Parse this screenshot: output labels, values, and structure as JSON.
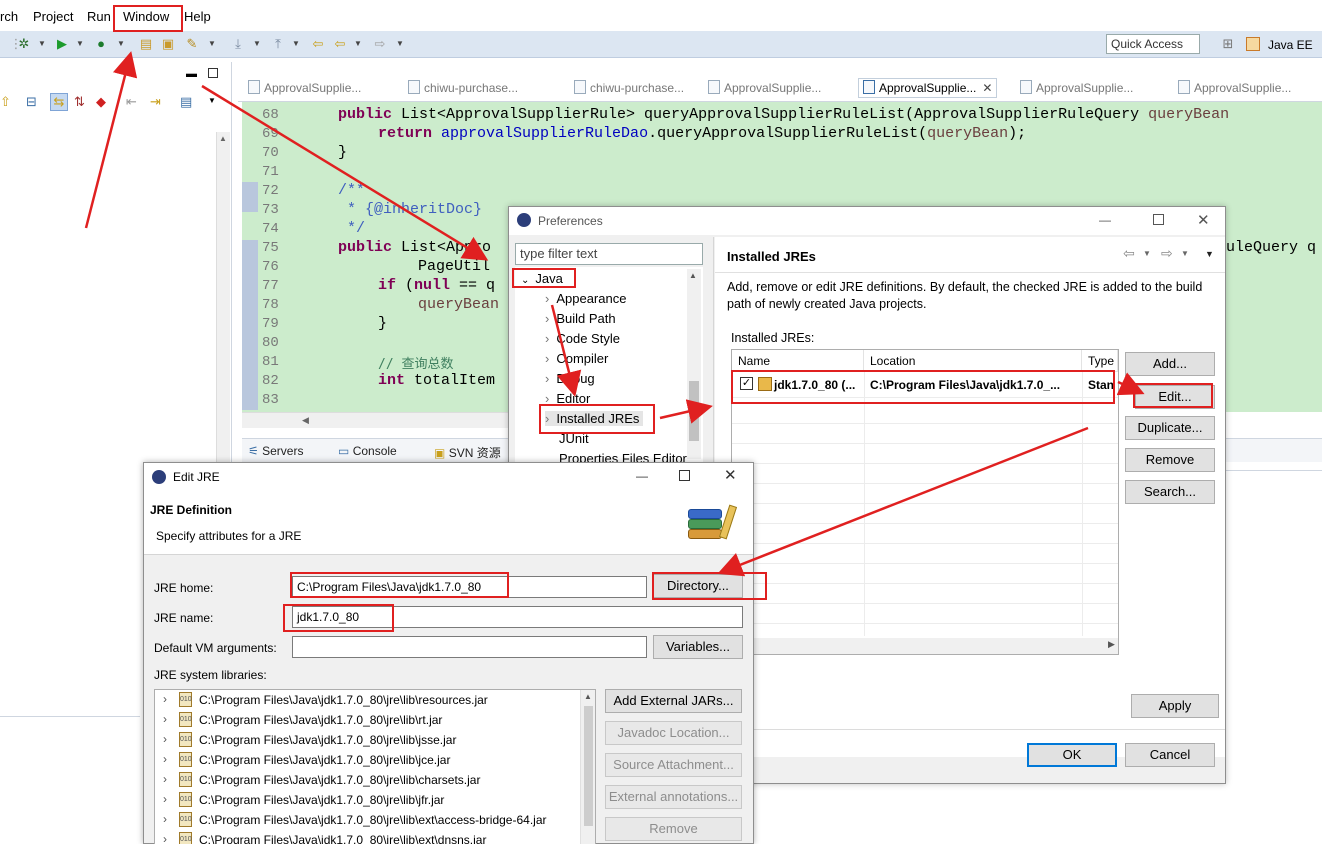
{
  "menubar": {
    "items": [
      "rch",
      "Project",
      "Run",
      "Window",
      "Help"
    ]
  },
  "toolbar": {
    "quick_access": "Quick Access",
    "perspective": "Java EE"
  },
  "editor": {
    "tabs": [
      "ApprovalSupplie...",
      "chiwu-purchase...",
      "chiwu-purchase...",
      "ApprovalSupplie...",
      "ApprovalSupplie...",
      "ApprovalSupplie...",
      "ApprovalSupplie..."
    ],
    "line_numbers": [
      "68",
      "69",
      "70",
      "71",
      "72",
      "73",
      "74",
      "75",
      "76",
      "77",
      "78",
      "79",
      "80",
      "81",
      "82",
      "83"
    ],
    "code": {
      "l68a": "public",
      "l68b": " List<ApprovalSupplierRule> queryApprovalSupplierRuleList(ApprovalSupplierRuleQuery ",
      "l68c": "queryBean",
      "l69a": "return",
      "l69b": "approvalSupplierRuleDao",
      "l69c": ".queryApprovalSupplierRuleList(",
      "l69d": "queryBean",
      "l69e": ");",
      "l70": "}",
      "l72": "/**",
      "l73": " * {@inheritDoc}",
      "l74": " */",
      "l75a": "public",
      "l75b": " List<Appro",
      "l75c": "uleQuery q",
      "l76": "PageUtil",
      "l77a": "if",
      "l77b": " (",
      "l77c": "null",
      "l77d": " == q",
      "l78": "queryBean",
      "l79": "}",
      "l81": "// 查询总数",
      "l82a": "int",
      "l82b": " totalItem"
    },
    "bottom_tabs": [
      "Servers",
      "Console",
      "SVN 资源"
    ]
  },
  "preferences": {
    "title": "Preferences",
    "filter_placeholder": "type filter text",
    "tree": {
      "root": "Java",
      "children": [
        "Appearance",
        "Build Path",
        "Code Style",
        "Compiler",
        "Debug",
        "Editor",
        "Installed JREs",
        "JUnit",
        "Properties Files Editor"
      ]
    },
    "page_title": "Installed JREs",
    "description": "Add, remove or edit JRE definitions. By default, the checked JRE is added to the build path of newly created Java projects.",
    "list_label": "Installed JREs:",
    "columns": [
      "Name",
      "Location",
      "Type"
    ],
    "rows": [
      {
        "name": "jdk1.7.0_80 (...",
        "location": "C:\\Program Files\\Java\\jdk1.7.0_...",
        "type": "Stan",
        "checked": true
      }
    ],
    "buttons": {
      "add": "Add...",
      "edit": "Edit...",
      "duplicate": "Duplicate...",
      "remove": "Remove",
      "search": "Search...",
      "apply": "Apply",
      "ok": "OK",
      "cancel": "Cancel"
    }
  },
  "edit_jre": {
    "title": "Edit JRE",
    "heading": "JRE Definition",
    "subheading": "Specify attributes for a JRE",
    "jre_home_label": "JRE home:",
    "jre_home_value": "C:\\Program Files\\Java\\jdk1.7.0_80",
    "directory_button": "Directory...",
    "jre_name_label": "JRE name:",
    "jre_name_value": "jdk1.7.0_80",
    "vm_args_label": "Default VM arguments:",
    "vm_args_value": "",
    "variables_button": "Variables...",
    "libraries_label": "JRE system libraries:",
    "libraries": [
      "C:\\Program Files\\Java\\jdk1.7.0_80\\jre\\lib\\resources.jar",
      "C:\\Program Files\\Java\\jdk1.7.0_80\\jre\\lib\\rt.jar",
      "C:\\Program Files\\Java\\jdk1.7.0_80\\jre\\lib\\jsse.jar",
      "C:\\Program Files\\Java\\jdk1.7.0_80\\jre\\lib\\jce.jar",
      "C:\\Program Files\\Java\\jdk1.7.0_80\\jre\\lib\\charsets.jar",
      "C:\\Program Files\\Java\\jdk1.7.0_80\\jre\\lib\\jfr.jar",
      "C:\\Program Files\\Java\\jdk1.7.0_80\\jre\\lib\\ext\\access-bridge-64.jar",
      "C:\\Program Files\\Java\\jdk1.7.0_80\\jre\\lib\\ext\\dnsns.jar"
    ],
    "lib_buttons": {
      "add_external": "Add External JARs...",
      "javadoc": "Javadoc Location...",
      "source": "Source Attachment...",
      "annotations": "External annotations...",
      "remove": "Remove"
    }
  },
  "colors": {
    "annotation_red": "#e02020",
    "editor_bg": "#cceccc",
    "toolbar_bg": "#dce6f2",
    "keyword": "#7f0055",
    "field": "#0000c0",
    "javadoc": "#3f5fbf",
    "accent": "#0078d7"
  }
}
